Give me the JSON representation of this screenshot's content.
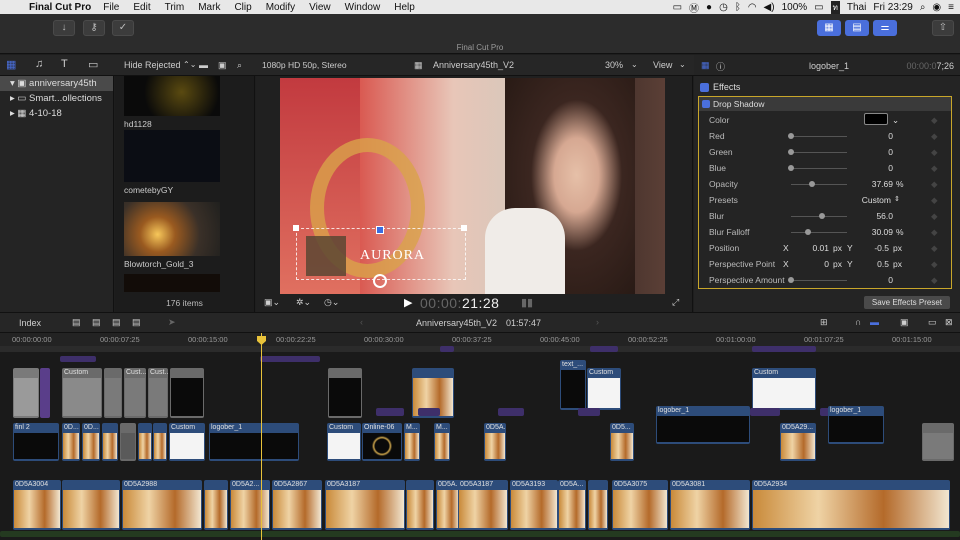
{
  "menubar": {
    "app": "Final Cut Pro",
    "items": [
      "File",
      "Edit",
      "Trim",
      "Mark",
      "Clip",
      "Modify",
      "View",
      "Window",
      "Help"
    ],
    "battery": "100%",
    "language": "Thai",
    "clock": "Fri 23:29"
  },
  "window": {
    "title": "Final Cut Pro"
  },
  "library": {
    "name": "anniversary45th",
    "items": [
      "Smart...ollections",
      "4-10-18"
    ],
    "filter": "Hide Rejected"
  },
  "browser": {
    "clips": [
      "hd1128",
      "cometebyGY",
      "Blowtorch_Gold_3"
    ],
    "count": "176 items"
  },
  "viewer": {
    "format": "1080p HD 50p, Stereo",
    "project": "Anniversary45th_V2",
    "zoom": "30%",
    "view_label": "View",
    "timecode_dim": "00:00:",
    "timecode": "21:28",
    "overlay_text": "AURORA"
  },
  "inspector": {
    "clip_name": "logober_1",
    "duration_dim": "00:00:0",
    "duration": "7;26",
    "effects_label": "Effects",
    "effect_name": "Drop Shadow",
    "params": [
      {
        "label": "Color",
        "value": ""
      },
      {
        "label": "Red",
        "value": "0"
      },
      {
        "label": "Green",
        "value": "0"
      },
      {
        "label": "Blue",
        "value": "0"
      },
      {
        "label": "Opacity",
        "value": "37.69",
        "unit": "%"
      },
      {
        "label": "Presets",
        "value": "Custom"
      },
      {
        "label": "Blur",
        "value": "56.0"
      },
      {
        "label": "Blur Falloff",
        "value": "30.09",
        "unit": "%"
      },
      {
        "label": "Position",
        "x": "0.01",
        "y": "-0.5",
        "unit": "px"
      },
      {
        "label": "Perspective Point",
        "x": "0",
        "y": "0.5",
        "unit": "px"
      },
      {
        "label": "Perspective Amount",
        "value": "0"
      }
    ],
    "x_label": "X",
    "y_label": "Y",
    "save_button": "Save Effects Preset"
  },
  "timeline": {
    "index_label": "Index",
    "project": "Anniversary45th_V2",
    "duration": "01:57:47",
    "ruler": [
      "00:00:00:00",
      "00:00:07:25",
      "00:00:15:00",
      "00:00:22:25",
      "00:00:30:00",
      "00:00:37:25",
      "00:00:45:00",
      "00:00:52:25",
      "00:01:00:00",
      "00:01:07:25",
      "00:01:15:00"
    ],
    "clips_row1": [
      "Custom",
      "Cust...",
      "Cust...",
      "text_...",
      "Custom",
      "Custom"
    ],
    "clips_row2": [
      "finl 2",
      "0D...",
      "0D...",
      "Custom",
      "logober_1",
      "Custom",
      "Online-06",
      "M...",
      "M...",
      "0D5A...",
      "0D5...",
      "logober_1",
      "0D5A29...",
      "logober_1"
    ],
    "clips_main": [
      "0D5A3004",
      "0D5A2988",
      "0D5A2...",
      "0D5A2867",
      "0D5A3187",
      "0D5A...",
      "0D5A3187",
      "0D5A3193",
      "0D5A...",
      "0D5A3075",
      "0D5A3081",
      "0D5A2934"
    ]
  },
  "colors": {
    "accent": "#4a6fdc",
    "selection": "#c8a62a",
    "playhead": "#e8c23a",
    "clip_blue": "#2d4c7a",
    "clip_purple": "#5a3e8a"
  }
}
